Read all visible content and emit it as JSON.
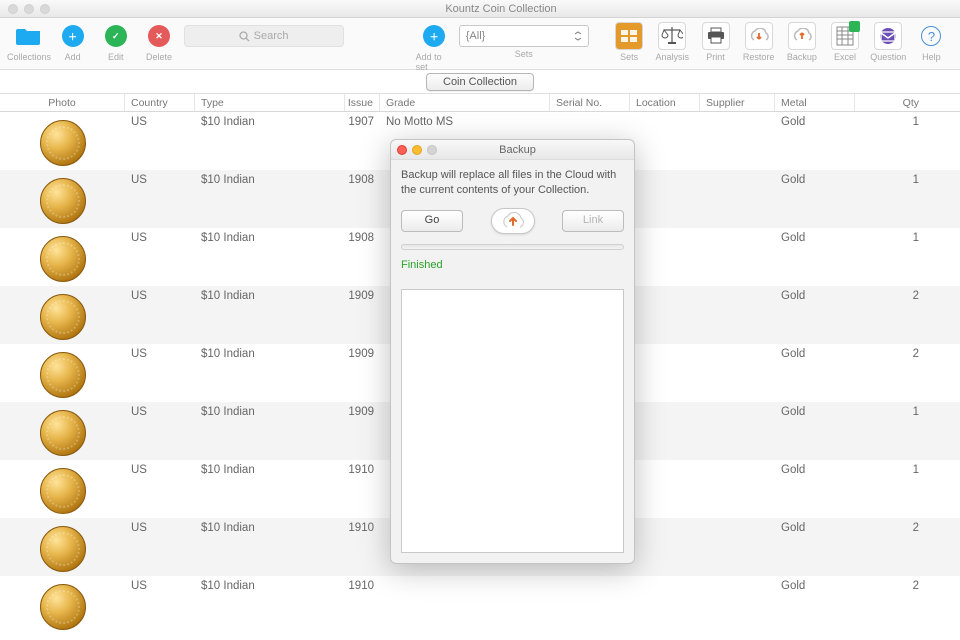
{
  "window": {
    "title": "Kountz  Coin Collection"
  },
  "toolbar": {
    "collections": "Collections",
    "add": "Add",
    "edit": "Edit",
    "delete": "Delete",
    "search_placeholder": "Search",
    "add_to_set": "Add to set",
    "sets": "Sets",
    "sets_select": "{All}",
    "setsBtn": "Sets",
    "analysis": "Analysis",
    "print": "Print",
    "restore": "Restore",
    "backup": "Backup",
    "excel": "Excel",
    "question": "Question",
    "help": "Help"
  },
  "collection_button": "Coin Collection",
  "columns": {
    "photo": "Photo",
    "country": "Country",
    "type": "Type",
    "issue": "Issue",
    "grade": "Grade",
    "serial": "Serial No.",
    "location": "Location",
    "supplier": "Supplier",
    "metal": "Metal",
    "qty": "Qty"
  },
  "rows": [
    {
      "country": "US",
      "type": "$10 Indian",
      "issue": "1907",
      "grade": "No Motto MS",
      "metal": "Gold",
      "qty": "1"
    },
    {
      "country": "US",
      "type": "$10 Indian",
      "issue": "1908",
      "grade": "",
      "metal": "Gold",
      "qty": "1"
    },
    {
      "country": "US",
      "type": "$10 Indian",
      "issue": "1908",
      "grade": "",
      "metal": "Gold",
      "qty": "1"
    },
    {
      "country": "US",
      "type": "$10 Indian",
      "issue": "1909",
      "grade": "",
      "metal": "Gold",
      "qty": "2"
    },
    {
      "country": "US",
      "type": "$10 Indian",
      "issue": "1909",
      "grade": "",
      "metal": "Gold",
      "qty": "2"
    },
    {
      "country": "US",
      "type": "$10 Indian",
      "issue": "1909",
      "grade": "",
      "metal": "Gold",
      "qty": "1"
    },
    {
      "country": "US",
      "type": "$10 Indian",
      "issue": "1910",
      "grade": "",
      "metal": "Gold",
      "qty": "1"
    },
    {
      "country": "US",
      "type": "$10 Indian",
      "issue": "1910",
      "grade": "",
      "metal": "Gold",
      "qty": "2"
    },
    {
      "country": "US",
      "type": "$10 Indian",
      "issue": "1910",
      "grade": "",
      "metal": "Gold",
      "qty": "2"
    }
  ],
  "dialog": {
    "title": "Backup",
    "message": "Backup will replace all files in the Cloud with the current contents of your Collection.",
    "go": "Go",
    "link": "Link",
    "status": "Finished"
  }
}
